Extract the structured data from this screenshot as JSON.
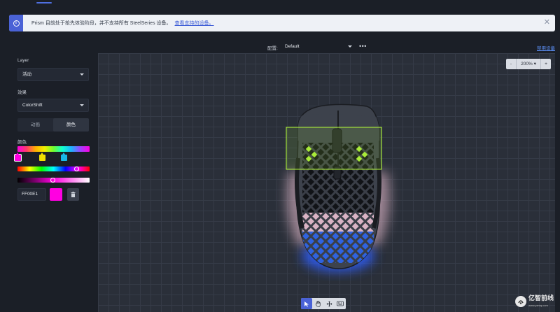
{
  "banner": {
    "message": "Prism 目前处于抢先体验阶段，并不支持所有 SteelSeries 设备。",
    "link": "查看支持的设备。"
  },
  "sidebar": {
    "layer_label": "Layer",
    "layer_value": "活动",
    "effect_label": "效果",
    "effect_value": "ColorShift",
    "tabs": [
      "动画",
      "颜色"
    ],
    "active_tab": 1,
    "color_label": "颜色",
    "hex_value": "FF00E1",
    "stops": [
      {
        "color": "#ff00e1",
        "position": 0.0
      },
      {
        "color": "#f0e000",
        "position": 0.33
      },
      {
        "color": "#18b8e8",
        "position": 0.66
      }
    ],
    "hue_position": 0.82,
    "saturation_position": 0.49
  },
  "config": {
    "label": "配置:",
    "value": "Default",
    "device_link": "禁用设备"
  },
  "zoom": {
    "minus": "-",
    "value": "200%",
    "plus": "+"
  },
  "colors": {
    "accent": "#4a62d6",
    "selected_color": "#ff00e1",
    "zone_highlight": "#b6ff3a"
  },
  "watermark": {
    "text": "亿智前线",
    "sub": "www.yzmq.com"
  }
}
